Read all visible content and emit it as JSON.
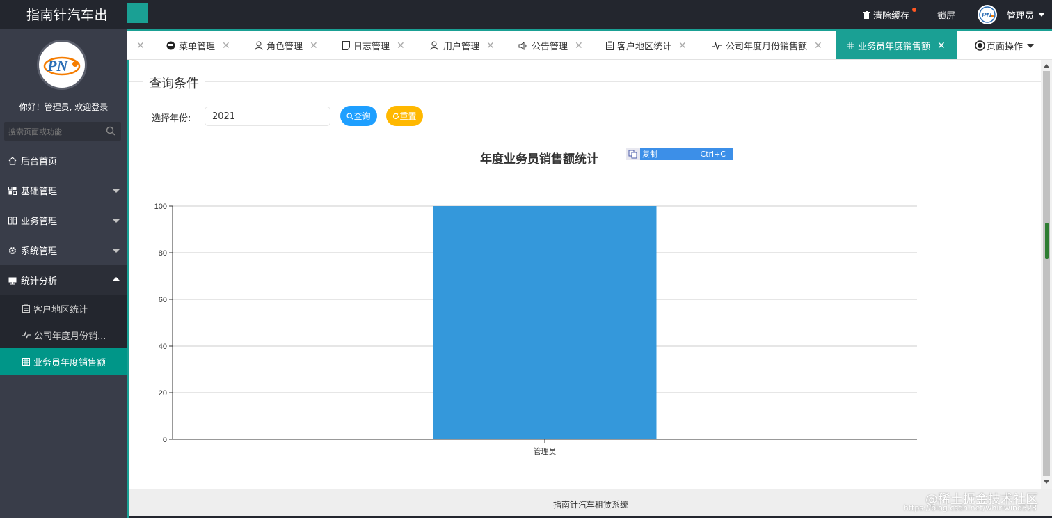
{
  "header": {
    "brand": "指南针汽车出",
    "clear_cache": "清除缓存",
    "lock": "锁屏",
    "user": "管理员"
  },
  "sidebar": {
    "welcome": "你好！管理员, 欢迎登录",
    "search_placeholder": "搜索页面或功能",
    "items": [
      {
        "label": "后台首页",
        "icon": "home-icon"
      },
      {
        "label": "基础管理",
        "icon": "apps-icon"
      },
      {
        "label": "业务管理",
        "icon": "book-icon"
      },
      {
        "label": "系统管理",
        "icon": "gear-icon"
      },
      {
        "label": "统计分析",
        "icon": "monitor-icon"
      }
    ],
    "sub_items": [
      {
        "label": "客户地区统计",
        "icon": "clipboard-icon"
      },
      {
        "label": "公司年度月份销...",
        "icon": "pulse-icon"
      },
      {
        "label": "业务员年度销售额",
        "icon": "table-icon"
      }
    ]
  },
  "tabs": [
    {
      "label": "菜单管理",
      "icon": "circle-lines-icon"
    },
    {
      "label": "角色管理",
      "icon": "user-icon"
    },
    {
      "label": "日志管理",
      "icon": "note-icon"
    },
    {
      "label": "用户管理",
      "icon": "users-icon"
    },
    {
      "label": "公告管理",
      "icon": "speaker-icon"
    },
    {
      "label": "客户地区统计",
      "icon": "clipboard-icon"
    },
    {
      "label": "公司年度月份销售额",
      "icon": "pulse-icon"
    },
    {
      "label": "业务员年度销售额",
      "icon": "table-icon"
    }
  ],
  "page_ops": "页面操作",
  "query": {
    "legend": "查询条件",
    "year_label": "选择年份:",
    "year_value": "2021",
    "query_button": "查询",
    "reset_button": "重置"
  },
  "context_menu": {
    "label": "复制",
    "shortcut": "Ctrl+C"
  },
  "chart_data": {
    "type": "bar",
    "title": "年度业务员销售额统计",
    "categories": [
      "管理员"
    ],
    "values": [
      100
    ],
    "ylim": [
      0,
      100
    ],
    "yticks": [
      0,
      20,
      40,
      60,
      80,
      100
    ],
    "xlabel": "",
    "ylabel": "",
    "grid": true,
    "bar_color": "#3498db"
  },
  "footer": {
    "text": "指南针汽车租赁系统",
    "watermark": "@稀土掘金技术社区",
    "watermark_url": "https://blog.csdn.net/whirlwind528"
  },
  "colors": {
    "accent": "#1aa094",
    "topbar": "#23262e",
    "sidebar": "#393d49",
    "query_btn": "#1e9fff",
    "reset_btn": "#ffb800"
  }
}
